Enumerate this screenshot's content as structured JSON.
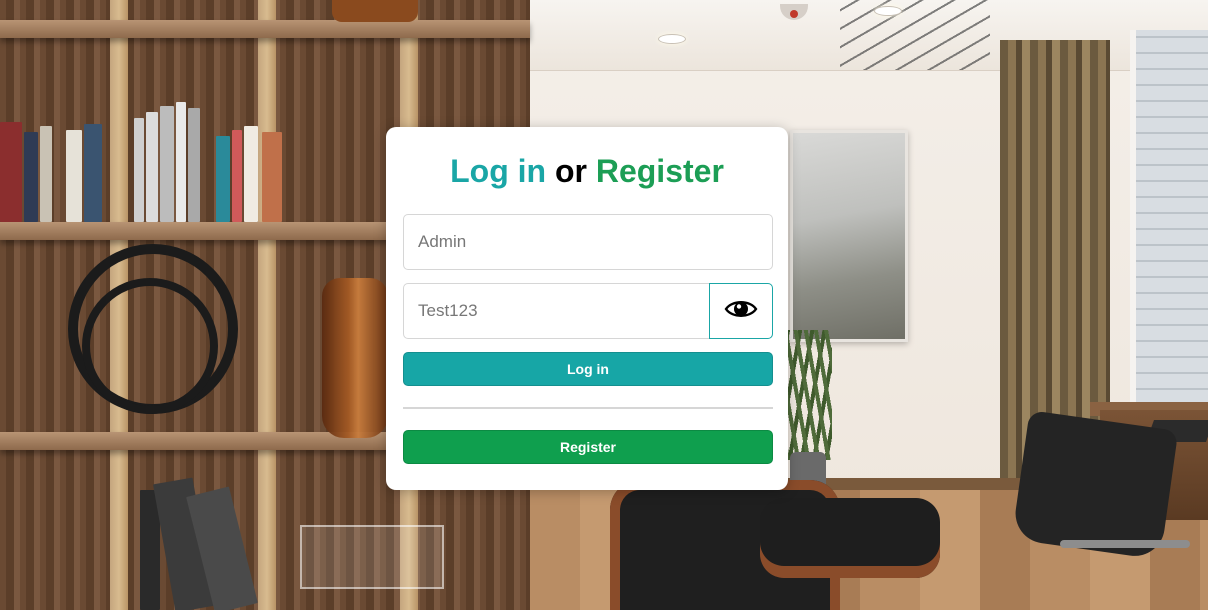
{
  "login_card": {
    "title": {
      "login_word": "Log in",
      "connector": "or",
      "register_word": "Register"
    },
    "username_field": {
      "placeholder": "Admin"
    },
    "password_field": {
      "placeholder": "Test123"
    },
    "toggle_password_icon": "eye-icon",
    "login_button_label": "Log in",
    "register_button_label": "Register"
  },
  "colors": {
    "accent_teal": "#17a6a6",
    "accent_green": "#0f9f4e",
    "card_background": "#ffffff"
  }
}
